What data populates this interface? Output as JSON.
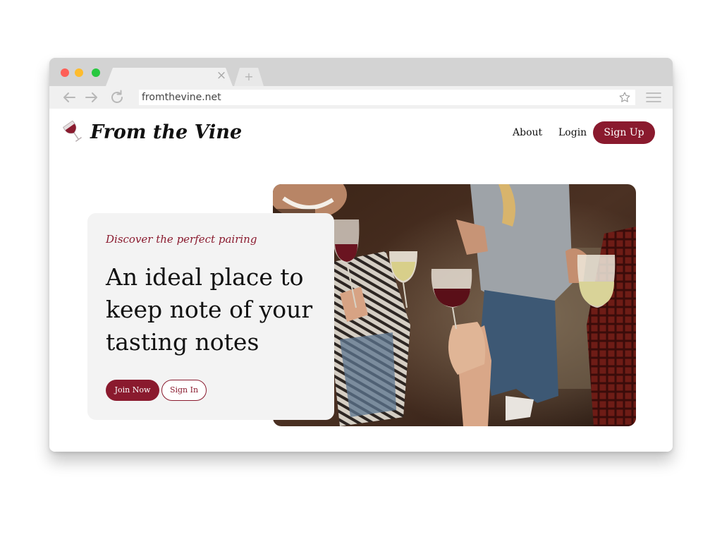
{
  "browser": {
    "url": "fromthevine.net",
    "traffic_lights": [
      "#fe5f57",
      "#febc2e",
      "#28c840"
    ],
    "tab_close": "×",
    "new_tab": "+"
  },
  "header": {
    "brand": "From the Vine",
    "nav": {
      "about": "About",
      "login": "Login",
      "signup": "Sign Up"
    }
  },
  "hero": {
    "eyebrow": "Discover the perfect pairing",
    "headline": "An ideal place to keep note of your tasting notes",
    "join_label": "Join Now",
    "signin_label": "Sign In"
  },
  "colors": {
    "accent": "#8a1a2e",
    "card_bg": "#f3f3f3",
    "chrome_bg": "#d3d3d3",
    "toolbar_bg": "#f0f0f0"
  }
}
